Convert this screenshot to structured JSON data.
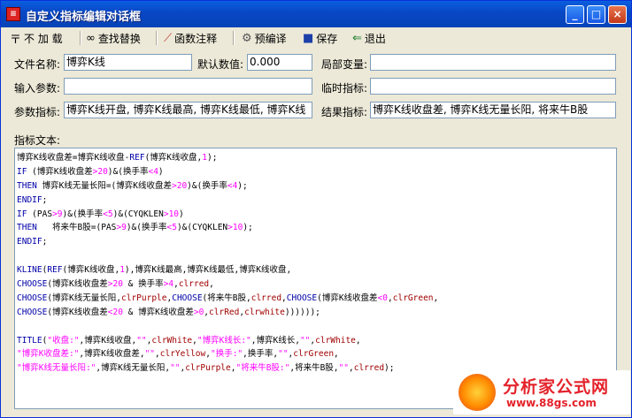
{
  "window": {
    "title": "自定义指标编辑对话框",
    "icon": "app-red-icon"
  },
  "title_buttons": {
    "minimize": "_",
    "maximize": "□",
    "close": "×"
  },
  "toolbar": {
    "no_load": {
      "label": "不 加 载",
      "icon": "pin-icon"
    },
    "find_replace": {
      "label": "查找替换",
      "icon": "binoculars-icon"
    },
    "func_comment": {
      "label": "函数注释",
      "icon": "wand-icon"
    },
    "precompile": {
      "label": "预编译",
      "icon": "compile-icon"
    },
    "save": {
      "label": "保存",
      "icon": "floppy-icon"
    },
    "exit": {
      "label": "退出",
      "icon": "exit-door-icon"
    }
  },
  "form": {
    "file_name_label": "文件名称:",
    "file_name_value": "博弈K线",
    "default_value_label": "默认数值:",
    "default_value": "0.000",
    "local_var_label": "局部变量:",
    "local_var_value": "",
    "input_params_label": "输入参数:",
    "input_params_value": "",
    "temp_indicator_label": "临时指标:",
    "temp_indicator_value": "",
    "param_indicator_label": "参数指标:",
    "param_indicator_value": "博弈K线开盘, 博弈K线最高, 博弈K线最低, 博弈K线",
    "result_indicator_label": "结果指标:",
    "result_indicator_value": "博弈K线收盘差, 博弈K线无量长阳, 将来牛B股",
    "indicator_text_label": "指标文本:"
  },
  "code_lines": [
    [
      [
        "",
        "博弈K线收盘差=博弈K线收盘-"
      ],
      [
        "kw",
        "REF"
      ],
      [
        "",
        "(博弈K线收盘,"
      ],
      [
        "nu",
        "1"
      ],
      [
        "",
        "); "
      ]
    ],
    [
      [
        "kw",
        "IF"
      ],
      [
        "",
        " (博弈K线收盘差"
      ],
      [
        "nu",
        ">20"
      ],
      [
        "",
        ")&(换手率"
      ],
      [
        "nu",
        "<4"
      ],
      [
        "",
        ")"
      ]
    ],
    [
      [
        "kw",
        "THEN"
      ],
      [
        "",
        " 博弈K线无量长阳=(博弈K线收盘差"
      ],
      [
        "nu",
        ">20"
      ],
      [
        "",
        ")&(换手率"
      ],
      [
        "nu",
        "<4"
      ],
      [
        "",
        ");"
      ]
    ],
    [
      [
        "kw",
        "ENDIF"
      ],
      [
        "",
        ";"
      ]
    ],
    [
      [
        "kw",
        "IF"
      ],
      [
        "",
        " (PAS"
      ],
      [
        "nu",
        ">9"
      ],
      [
        "",
        ")&(换手率"
      ],
      [
        "nu",
        "<5"
      ],
      [
        "",
        ")&(CYQKLEN"
      ],
      [
        "nu",
        ">10"
      ],
      [
        "",
        ")"
      ]
    ],
    [
      [
        "kw",
        "THEN"
      ],
      [
        "",
        "   将来牛B股=(PAS"
      ],
      [
        "nu",
        ">9"
      ],
      [
        "",
        ")&(换手率"
      ],
      [
        "nu",
        "<5"
      ],
      [
        "",
        ")&(CYQKLEN"
      ],
      [
        "nu",
        ">10"
      ],
      [
        "",
        ");"
      ]
    ],
    [
      [
        "kw",
        "ENDIF"
      ],
      [
        "",
        ";"
      ]
    ],
    [
      [
        "",
        ""
      ]
    ],
    [
      [
        "kw",
        "KLINE"
      ],
      [
        "",
        "("
      ],
      [
        "kw",
        "REF"
      ],
      [
        "",
        "(博弈K线收盘,"
      ],
      [
        "nu",
        "1"
      ],
      [
        "",
        "),博弈K线最高,博弈K线最低,博弈K线收盘,"
      ]
    ],
    [
      [
        "kw",
        "CHOOSE"
      ],
      [
        "",
        "(博弈K线收盘差"
      ],
      [
        "nu",
        ">20"
      ],
      [
        "",
        " & 换手率"
      ],
      [
        "nu",
        ">4"
      ],
      [
        "",
        ","
      ],
      [
        "cl",
        "clrred"
      ],
      [
        "",
        ","
      ]
    ],
    [
      [
        "kw",
        "CHOOSE"
      ],
      [
        "",
        "(博弈K线无量长阳,"
      ],
      [
        "cl",
        "clrPurple"
      ],
      [
        "",
        ","
      ],
      [
        "kw",
        "CHOOSE"
      ],
      [
        "",
        "(将来牛B股,"
      ],
      [
        "cl",
        "clrred"
      ],
      [
        "",
        ","
      ],
      [
        "kw",
        "CHOOSE"
      ],
      [
        "",
        "(博弈K线收盘差"
      ],
      [
        "nu",
        "<0"
      ],
      [
        "",
        ","
      ],
      [
        "cl",
        "clrGreen"
      ],
      [
        "",
        ","
      ]
    ],
    [
      [
        "kw",
        "CHOOSE"
      ],
      [
        "",
        "(博弈K线收盘差"
      ],
      [
        "nu",
        "<20"
      ],
      [
        "",
        " & 博弈K线收盘差"
      ],
      [
        "nu",
        ">0"
      ],
      [
        "",
        ","
      ],
      [
        "cl",
        "clrRed"
      ],
      [
        "",
        ","
      ],
      [
        "cl",
        "clrwhite"
      ],
      [
        "",
        "))))));"
      ]
    ],
    [
      [
        "",
        ""
      ]
    ],
    [
      [
        "kw",
        "TITLE"
      ],
      [
        "",
        "("
      ],
      [
        "st",
        "\"收盘:\""
      ],
      [
        "",
        ",博弈K线收盘,"
      ],
      [
        "st",
        "\"\""
      ],
      [
        "",
        ","
      ],
      [
        "cl",
        "clrWhite"
      ],
      [
        "",
        ","
      ],
      [
        "st",
        "\"博弈K线长:\""
      ],
      [
        "",
        ",博弈K线长,"
      ],
      [
        "st",
        "\"\""
      ],
      [
        "",
        ","
      ],
      [
        "cl",
        "clrWhite"
      ],
      [
        "",
        ","
      ]
    ],
    [
      [
        "st",
        "\"博弈K收盘差:\""
      ],
      [
        "",
        ",博弈K线收盘差,"
      ],
      [
        "st",
        "\"\""
      ],
      [
        "",
        ","
      ],
      [
        "cl",
        "clrYellow"
      ],
      [
        "",
        ","
      ],
      [
        "st",
        "\"换手:\""
      ],
      [
        "",
        ",换手率,"
      ],
      [
        "st",
        "\"\""
      ],
      [
        "",
        ","
      ],
      [
        "cl",
        "clrGreen"
      ],
      [
        "",
        ","
      ]
    ],
    [
      [
        "st",
        "\"博弈K线无量长阳:\""
      ],
      [
        "",
        ",博弈K线无量长阳,"
      ],
      [
        "st",
        "\"\""
      ],
      [
        "",
        ","
      ],
      [
        "cl",
        "clrPurple"
      ],
      [
        "",
        ","
      ],
      [
        "st",
        "\"将来牛B股:\""
      ],
      [
        "",
        ",将来牛B股,"
      ],
      [
        "st",
        "\"\""
      ],
      [
        "",
        ","
      ],
      [
        "cl",
        "clrred"
      ],
      [
        "",
        "); "
      ]
    ]
  ],
  "watermark": {
    "brand": "分析家公式网",
    "url": "www.88gs.com"
  }
}
